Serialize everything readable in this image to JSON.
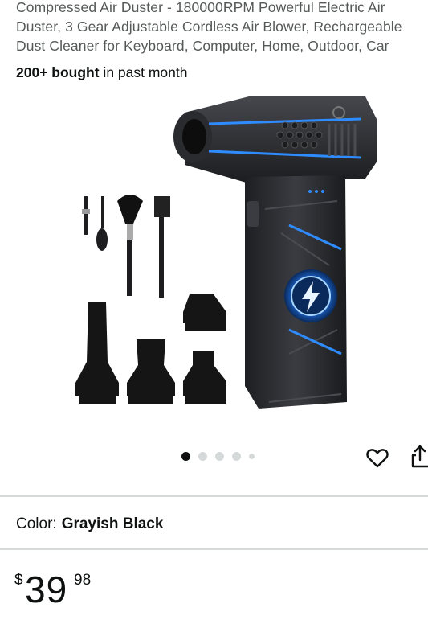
{
  "product": {
    "title_lines": [
      "Compressed Air Duster - 180000RPM Powerful Electric Air",
      "Duster, 3 Gear Adjustable Cordless Air Blower, Rechargeable",
      "Dust Cleaner for Keyboard, Computer, Home, Outdoor, Car"
    ],
    "bought_strong": "200+ bought",
    "bought_rest": " in past month",
    "image_alt": "Electric air duster with brushes and nozzle attachments"
  },
  "carousel": {
    "total": 5,
    "active_index": 0
  },
  "actions": {
    "wishlist_icon": "heart-icon",
    "share_icon": "share-icon"
  },
  "color": {
    "label": "Color:",
    "value": "Grayish Black"
  },
  "price": {
    "symbol": "$",
    "whole": "39",
    "fraction": "98"
  },
  "colors": {
    "accent_blue": "#2f8cff",
    "body_dark": "#2b2d31"
  }
}
